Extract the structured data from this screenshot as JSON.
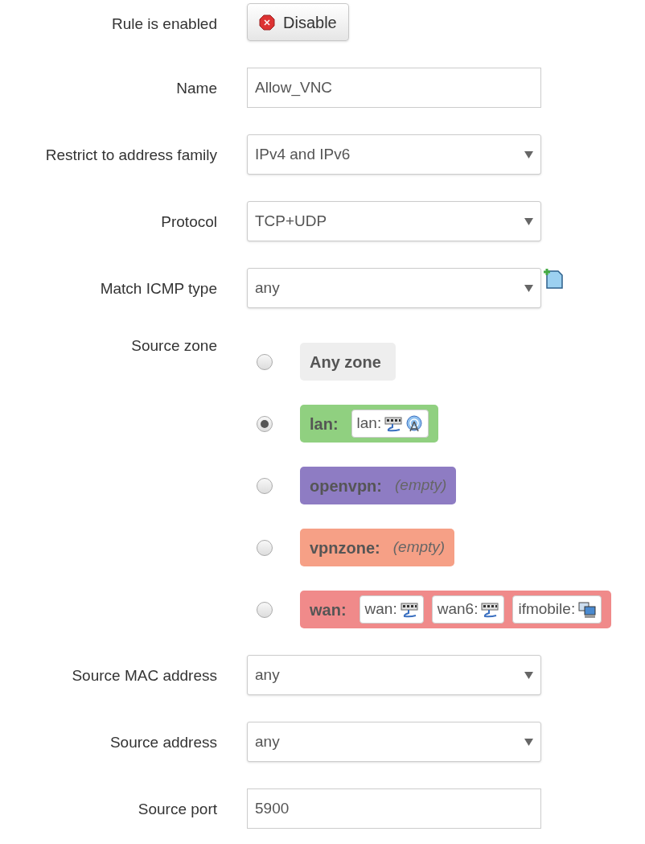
{
  "fields": [
    {
      "kind": "button",
      "label": "Rule is enabled",
      "button": "Disable"
    },
    {
      "kind": "text",
      "label": "Name",
      "value": "Allow_VNC"
    },
    {
      "kind": "select",
      "label": "Restrict to address family",
      "value": "IPv4 and IPv6"
    },
    {
      "kind": "select",
      "label": "Protocol",
      "value": "TCP+UDP"
    },
    {
      "kind": "select",
      "label": "Match ICMP type",
      "value": "any",
      "add_button": true
    },
    {
      "kind": "zones",
      "label": "Source zone",
      "zones": [
        {
          "name": "Any zone",
          "selected": false,
          "color": "#eeeeee"
        },
        {
          "name": "lan:",
          "selected": true,
          "color": "#90d080",
          "interfaces": [
            {
              "name": "lan:",
              "icons": [
                {
                  "kind": "ethernet"
                },
                {
                  "kind": "wifi"
                }
              ]
            }
          ]
        },
        {
          "name": "openvpn:",
          "selected": false,
          "color": "#8e7cc3",
          "empty": "(empty)"
        },
        {
          "name": "vpnzone:",
          "selected": false,
          "color": "#f6a086",
          "empty": "(empty)"
        },
        {
          "name": "wan:",
          "selected": false,
          "color": "#f08a8a",
          "interfaces": [
            {
              "name": "wan:",
              "icons": [
                {
                  "kind": "ethernet"
                }
              ]
            },
            {
              "name": "wan6:",
              "icons": [
                {
                  "kind": "ethernet"
                }
              ]
            },
            {
              "name": "ifmobile:",
              "icons": [
                {
                  "kind": "monitors"
                }
              ]
            }
          ]
        }
      ]
    },
    {
      "kind": "select",
      "label": "Source MAC address",
      "value": "any"
    },
    {
      "kind": "select",
      "label": "Source address",
      "value": "any"
    },
    {
      "kind": "text",
      "label": "Source port",
      "value": "5900"
    }
  ]
}
